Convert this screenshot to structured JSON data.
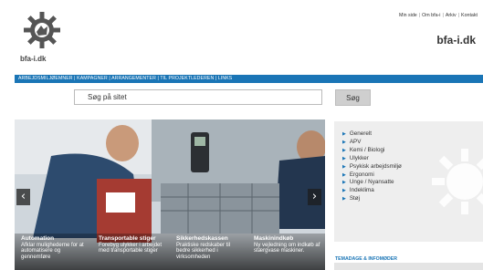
{
  "header": {
    "logo_text": "bfa-i.dk",
    "brand": "bfa-i.dk",
    "top_links": [
      "Min side",
      "Om bfa-i",
      "Arkiv",
      "Kontakt"
    ]
  },
  "nav": {
    "text": "ARBEJDSMILJØEMNER | KAMPAGNER | ARRANGEMENTER | TIL PROJEKTLEDEREN | LINKS"
  },
  "search": {
    "value": "Søg på sitet",
    "button": "Søg"
  },
  "slider": {
    "prev_glyph": "‹",
    "next_glyph": "›",
    "captions": [
      {
        "title": "Automation",
        "text": "Afklar mulighederne for at automatisere og gennemføre"
      },
      {
        "title": "Transportable stiger",
        "text": "Forebyg ulykker i arbejdet med transportable stiger"
      },
      {
        "title": "Sikkerhedskassen",
        "text": "Praktiske redskaber til bedre sikkerhed i virksomheden"
      },
      {
        "title": "Maskinindkøb",
        "text": "Ny vejledning om indkøb af stærgvase maskiner."
      }
    ]
  },
  "sidebar": {
    "items": [
      "Generelt",
      "APV",
      "Kemi / Biologi",
      "Ulykker",
      "Psykisk arbejdsmiljø",
      "Ergonomi",
      "Unge / Nyansatte",
      "Indeklima",
      "Støj"
    ],
    "section_title": "TEMADAGE & INFOMØDER"
  },
  "colors": {
    "accent": "#1a75b6",
    "sidebar_bg": "#eeeeee"
  }
}
